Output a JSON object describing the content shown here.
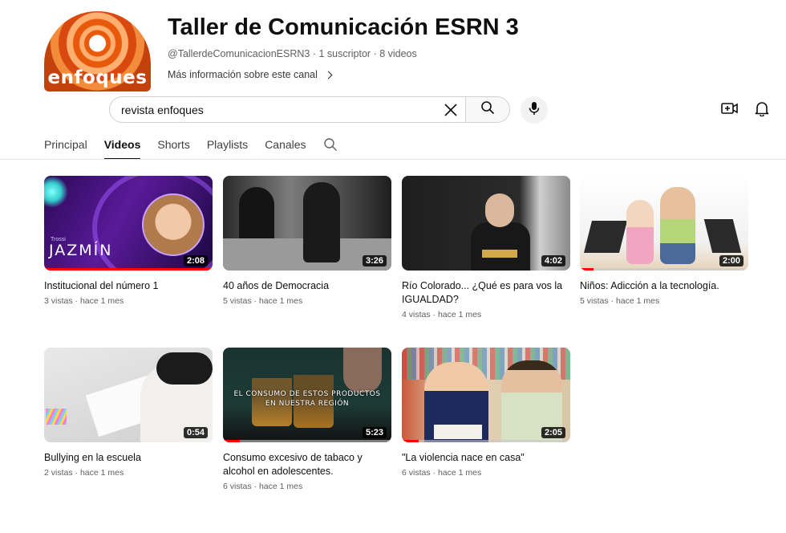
{
  "channel": {
    "avatar_text": "enfoques",
    "title": "Taller de Comunicación ESRN 3",
    "handle": "@TallerdeComunicacionESRN3",
    "subscribers": "1 suscriptor",
    "video_count": "8 videos",
    "meta_separator": " · ",
    "more_info": "Más información sobre este canal"
  },
  "search": {
    "value": "revista enfoques"
  },
  "icons": {
    "clear": "close-icon",
    "search": "search-icon",
    "mic": "microphone-icon",
    "create": "create-video-icon",
    "notifications": "bell-icon",
    "more_info": "chevron-right-icon",
    "tab_search": "search-icon"
  },
  "tabs": [
    {
      "label": "Principal",
      "active": false
    },
    {
      "label": "Videos",
      "active": true
    },
    {
      "label": "Shorts",
      "active": false
    },
    {
      "label": "Playlists",
      "active": false
    },
    {
      "label": "Canales",
      "active": false
    }
  ],
  "videos": [
    {
      "title": "Institucional del número 1",
      "duration": "2:08",
      "views": "3 vistas",
      "age": "hace 1 mes",
      "thumb_text": "JAZMÍN",
      "thumb_small_text": "Trossi",
      "watched_fraction": 1.0
    },
    {
      "title": "40 años de Democracia",
      "duration": "3:26",
      "views": "5 vistas",
      "age": "hace 1 mes",
      "watched_fraction": 0
    },
    {
      "title": "Río Colorado... ¿Qué es para vos la IGUALDAD?",
      "duration": "4:02",
      "views": "4 vistas",
      "age": "hace 1 mes",
      "watched_fraction": 0
    },
    {
      "title": "Niños: Adicción a la tecnología.",
      "duration": "2:00",
      "views": "5 vistas",
      "age": "hace 1 mes",
      "watched_fraction": 0.08
    },
    {
      "title": "Bullying en la escuela",
      "duration": "0:54",
      "views": "2 vistas",
      "age": "hace 1 mes",
      "watched_fraction": 0
    },
    {
      "title": "Consumo excesivo de tabaco y alcohol en adolescentes.",
      "duration": "5:23",
      "views": "6 vistas",
      "age": "hace 1 mes",
      "thumb_text": "EL CONSUMO DE ESTOS PRODUCTOS EN NUESTRA REGIÓN",
      "watched_fraction": 0.1
    },
    {
      "title": "\"La violencia nace en casa\"",
      "duration": "2:05",
      "views": "6 vistas",
      "age": "hace 1 mes",
      "watched_fraction": 0.1
    }
  ],
  "meta_separator": " · "
}
